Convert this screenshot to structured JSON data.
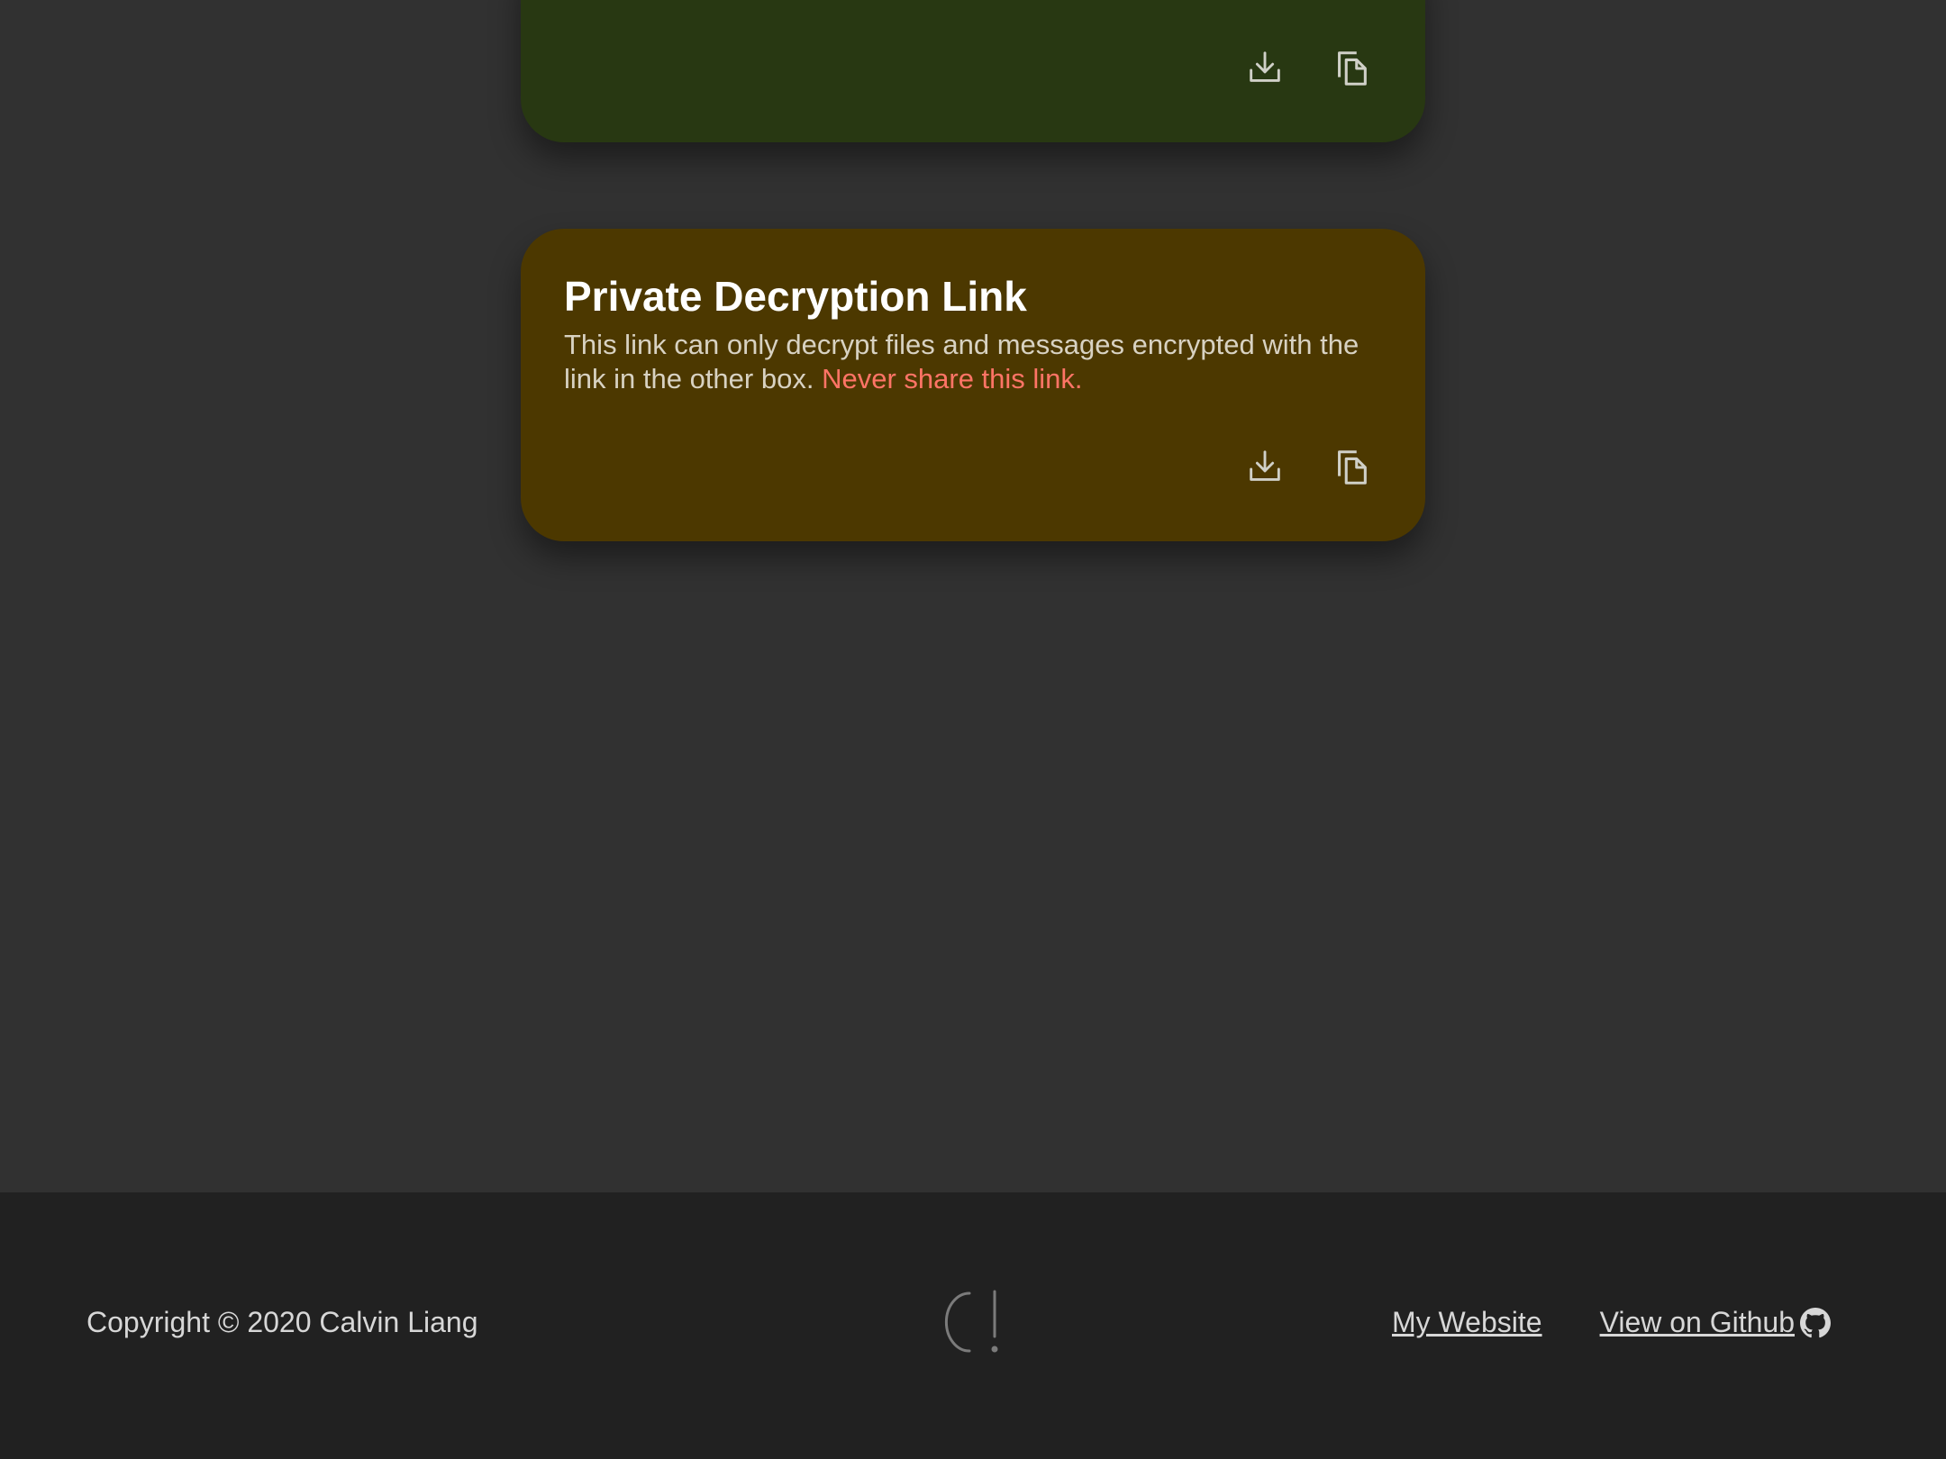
{
  "cards": {
    "public": {
      "download_icon": "download-icon",
      "copy_icon": "copy-icon",
      "background": "#283812"
    },
    "private": {
      "title": "Private Decryption Link",
      "description": "This link can only decrypt files and messages encrypted with the link in the other box.",
      "warning": "Never share this link.",
      "download_icon": "download-icon",
      "copy_icon": "copy-icon",
      "background": "#4c3800",
      "warning_color": "#ff7466"
    }
  },
  "footer": {
    "copyright": "Copyright © 2020 Calvin Liang",
    "logo_icon": "logo-icon",
    "links": {
      "website": "My Website",
      "github": "View on Github"
    },
    "github_icon": "github-icon"
  },
  "colors": {
    "page_background": "#313131",
    "footer_background": "#212121"
  }
}
